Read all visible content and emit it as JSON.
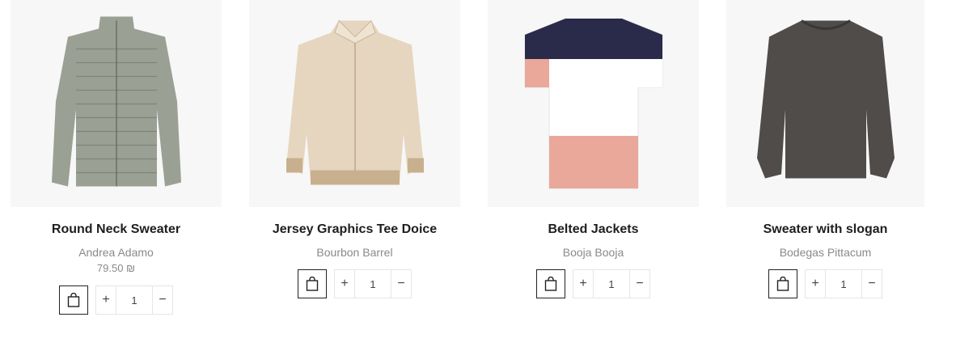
{
  "products": [
    {
      "title": "Round Neck Sweater",
      "brand": "Andrea Adamo",
      "price": "79.50 ₪",
      "qty": "1",
      "image": "puffer-jacket",
      "color": "#9aa094"
    },
    {
      "title": "Jersey Graphics Tee Doice",
      "brand": "Bourbon Barrel",
      "price": "",
      "qty": "1",
      "image": "suede-bomber-jacket",
      "color": "#e6d6bf"
    },
    {
      "title": "Belted Jackets",
      "brand": "Booja Booja",
      "price": "",
      "qty": "1",
      "image": "colorblock-tshirt",
      "color": "#2a2a4a"
    },
    {
      "title": "Sweater with slogan",
      "brand": "Bodegas Pittacum",
      "price": "",
      "qty": "1",
      "image": "grey-sweatshirt",
      "color": "#4f4c4a"
    }
  ],
  "controls": {
    "plus": "+",
    "minus": "−"
  }
}
